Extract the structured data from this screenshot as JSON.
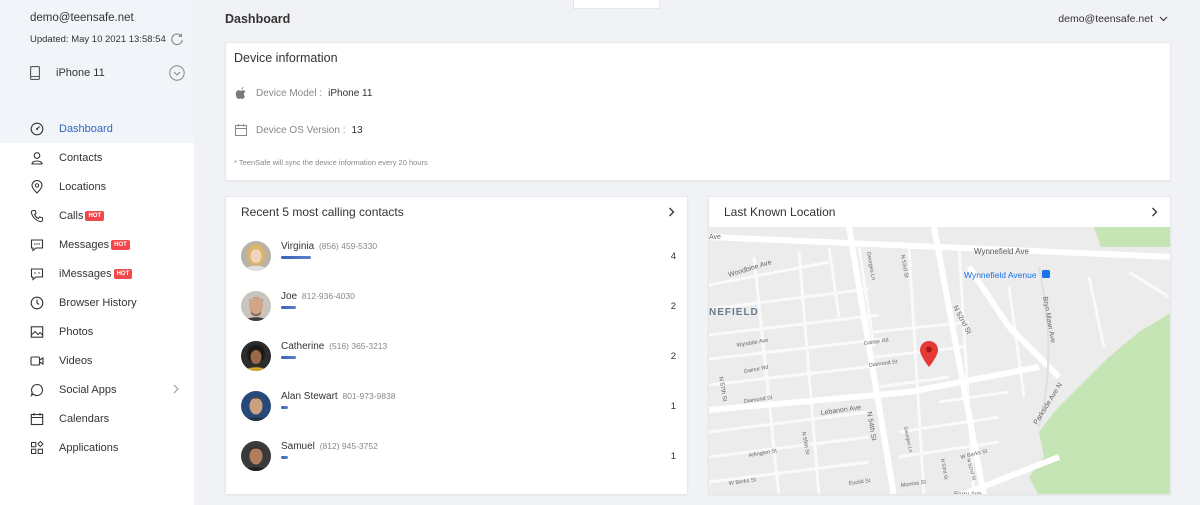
{
  "sidebar": {
    "email": "demo@teensafe.net",
    "updated": "Updated: May 10 2021 13:58:54",
    "device_name": "iPhone 11",
    "items": [
      {
        "label": "Dashboard",
        "icon": "dashboard-icon",
        "active": true
      },
      {
        "label": "Contacts",
        "icon": "contacts-icon"
      },
      {
        "label": "Locations",
        "icon": "location-pin-icon"
      },
      {
        "label": "Calls",
        "icon": "phone-icon",
        "badge": "HOT"
      },
      {
        "label": "Messages",
        "icon": "message-icon",
        "badge": "HOT"
      },
      {
        "label": "iMessages",
        "icon": "imessage-icon",
        "badge": "HOT"
      },
      {
        "label": "Browser History",
        "icon": "clock-icon"
      },
      {
        "label": "Photos",
        "icon": "image-icon"
      },
      {
        "label": "Videos",
        "icon": "video-icon"
      },
      {
        "label": "Social Apps",
        "icon": "chat-bubble-icon"
      },
      {
        "label": "Calendars",
        "icon": "calendar-icon"
      },
      {
        "label": "Applications",
        "icon": "apps-grid-icon"
      }
    ]
  },
  "header": {
    "title": "Dashboard",
    "user": "demo@teensafe.net"
  },
  "device_info": {
    "title": "Device information",
    "model_label": "Device Model :",
    "model_value": "iPhone 11",
    "os_label": "Device OS Version :",
    "os_value": "13",
    "note": "* TeenSafe will sync the device information every 20 hours"
  },
  "recent_calls": {
    "title": "Recent 5 most calling contacts",
    "contacts": [
      {
        "name": "Virginia",
        "phone": "(856) 459-5330",
        "count": "4",
        "bar_fraction": 0.136
      },
      {
        "name": "Joe",
        "phone": "812-936-4030",
        "count": "2",
        "bar_fraction": 0.068
      },
      {
        "name": "Catherine",
        "phone": "(516) 365-3213",
        "count": "2",
        "bar_fraction": 0.068
      },
      {
        "name": "Alan Stewart",
        "phone": "801-973-9838",
        "count": "1",
        "bar_fraction": 0.034
      },
      {
        "name": "Samuel",
        "phone": "(812) 945-3752",
        "count": "1",
        "bar_fraction": 0.034
      }
    ]
  },
  "location": {
    "title": "Last Known Location",
    "map_labels": {
      "ave_top": "Ave",
      "woodbine": "Woodbine Ave",
      "wynnefield_ave": "Wynnefield Ave",
      "wynnefield_station": "Wynnefield Avenue",
      "nefield": "NEFIELD",
      "georges": "Georges Ln",
      "n53": "N 53rd St",
      "n52": "N 52nd St",
      "bryn": "Bryn Mawr Ave",
      "wyndale": "Wyndale Ave",
      "gainor": "Gainor Rd",
      "gainor2": "Gainor Rd",
      "n57": "N 57th St",
      "diamond": "Diamond St",
      "diamond2": "Diamond St",
      "lebanon": "Lebanon Ave",
      "n54": "N 54th St",
      "georges2": "Georges Ln",
      "parkside": "Parkside Ave N",
      "wberks": "W Berks St",
      "wberks2": "W Berks St",
      "arlington": "Arlington St",
      "n55": "N 55th St",
      "euclid": "Euclid St",
      "monroe": "Monroe St",
      "n53b": "N 53rd St",
      "n52b": "N 52nd St",
      "ferry": "Ferry Ave"
    }
  },
  "colors": {
    "accent": "#2e65c4",
    "hot_badge": "#f0484b",
    "park": "#c5e5b4",
    "pin": "#e53935"
  }
}
